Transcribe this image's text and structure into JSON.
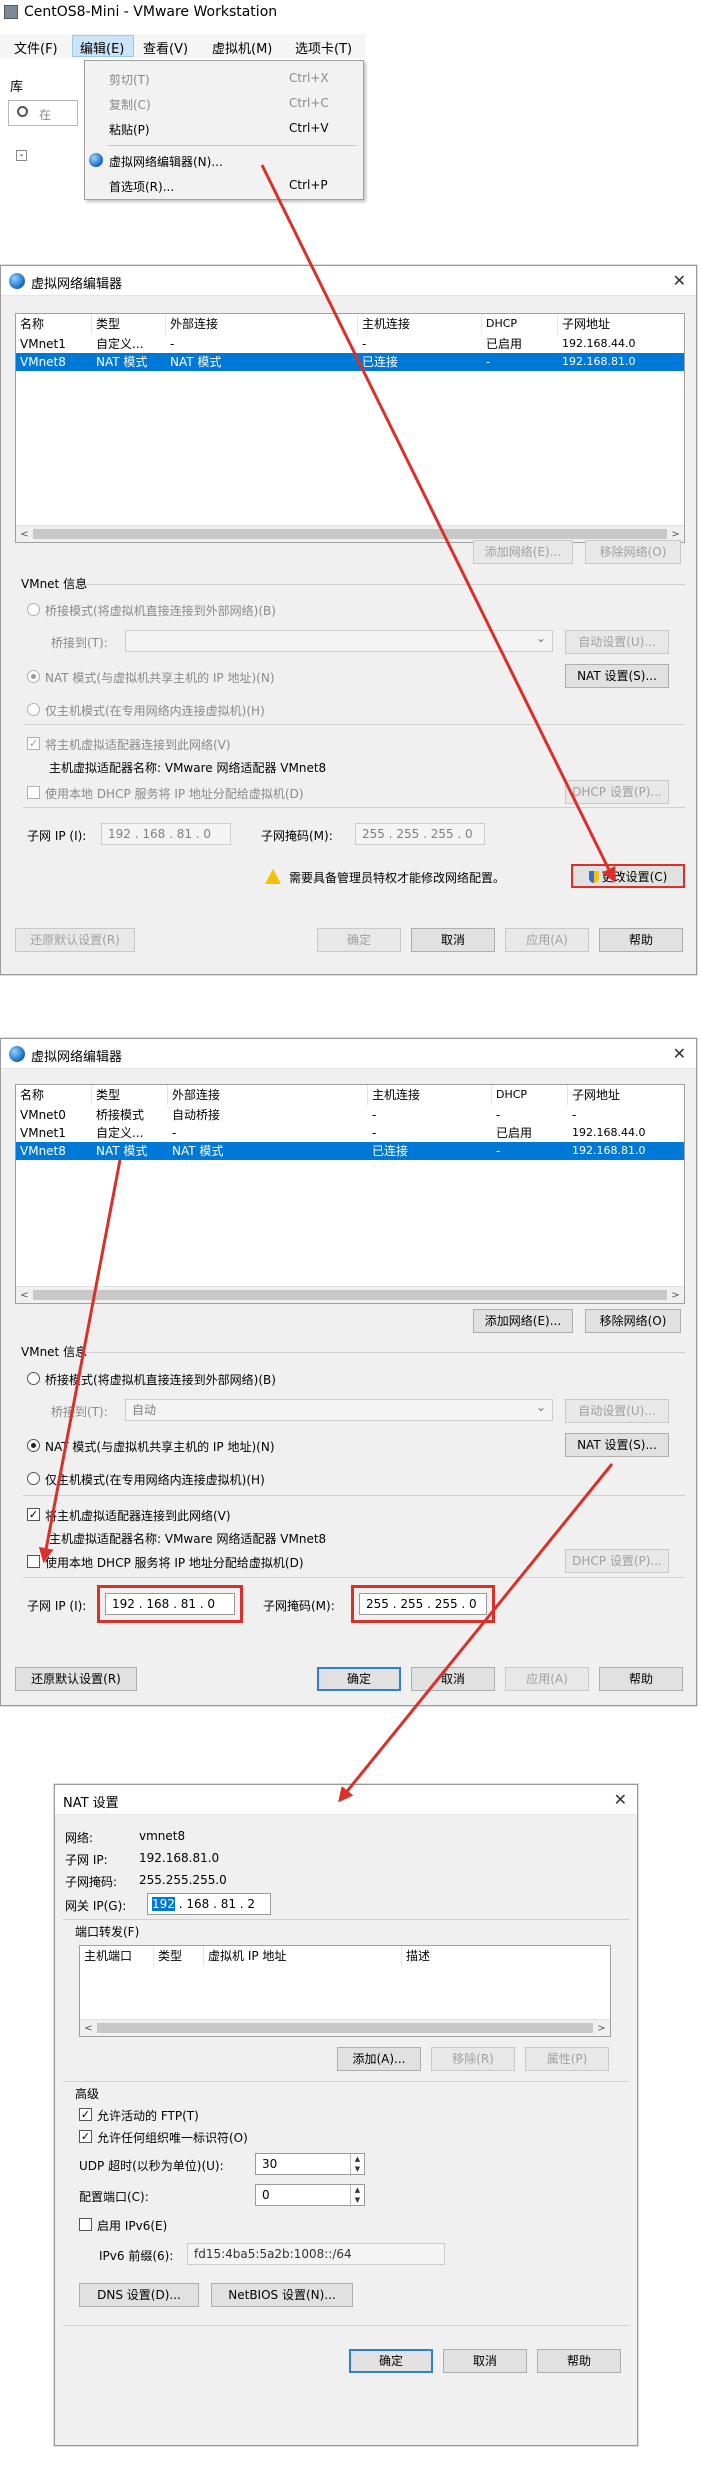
{
  "menu_window": {
    "title": "CentOS8-Mini - VMware Workstation",
    "menubar": [
      "文件(F)",
      "编辑(E)",
      "查看(V)",
      "虚拟机(M)",
      "选项卡(T)"
    ],
    "sidebar_label": "库",
    "search_placeholder": "在",
    "edit_menu": [
      {
        "label": "剪切(T)",
        "shortcut": "Ctrl+X"
      },
      {
        "label": "复制(C)",
        "shortcut": "Ctrl+C"
      },
      {
        "label": "粘贴(P)",
        "shortcut": "Ctrl+V"
      },
      {
        "label": "虚拟网络编辑器(N)...",
        "shortcut": ""
      },
      {
        "label": "首选项(R)...",
        "shortcut": "Ctrl+P"
      }
    ]
  },
  "vne1": {
    "title": "虚拟网络编辑器",
    "columns": [
      "名称",
      "类型",
      "外部连接",
      "主机连接",
      "DHCP",
      "子网地址"
    ],
    "rows": [
      [
        "VMnet1",
        "自定义...",
        "-",
        "-",
        "已启用",
        "192.168.44.0"
      ],
      [
        "VMnet8",
        "NAT 模式",
        "NAT 模式",
        "已连接",
        "-",
        "192.168.81.0"
      ]
    ],
    "add_network": "添加网络(E)...",
    "remove_network": "移除网络(O)",
    "vmnet_info": "VMnet 信息",
    "bridged": "桥接模式(将虚拟机直接连接到外部网络)(B)",
    "bridge_to": "桥接到(T):",
    "bridge_value": "",
    "auto_settings": "自动设置(U)...",
    "nat_mode": "NAT 模式(与虚拟机共享主机的 IP 地址)(N)",
    "nat_settings": "NAT 设置(S)...",
    "hostonly": "仅主机模式(在专用网络内连接虚拟机)(H)",
    "connect_adapter": "将主机虚拟适配器连接到此网络(V)",
    "adapter_name": "主机虚拟适配器名称: VMware 网络适配器 VMnet8",
    "use_dhcp": "使用本地 DHCP 服务将 IP 地址分配给虚拟机(D)",
    "dhcp_settings": "DHCP 设置(P)...",
    "subnet_ip_label": "子网 IP (I):",
    "subnet_ip": "192 . 168 . 81 . 0",
    "mask_label": "子网掩码(M):",
    "mask": "255 . 255 . 255 . 0",
    "admin_notice": "需要具备管理员特权才能修改网络配置。",
    "change_settings": "更改设置(C)",
    "restore": "还原默认设置(R)",
    "ok": "确定",
    "cancel": "取消",
    "apply": "应用(A)",
    "help": "帮助"
  },
  "vne2": {
    "title": "虚拟网络编辑器",
    "columns": [
      "名称",
      "类型",
      "外部连接",
      "主机连接",
      "DHCP",
      "子网地址"
    ],
    "rows": [
      [
        "VMnet0",
        "桥接模式",
        "自动桥接",
        "-",
        "-",
        "-"
      ],
      [
        "VMnet1",
        "自定义...",
        "-",
        "-",
        "已启用",
        "192.168.44.0"
      ],
      [
        "VMnet8",
        "NAT 模式",
        "NAT 模式",
        "已连接",
        "-",
        "192.168.81.0"
      ]
    ],
    "add_network": "添加网络(E)...",
    "remove_network": "移除网络(O)",
    "vmnet_info": "VMnet 信息",
    "bridged": "桥接模式(将虚拟机直接连接到外部网络)(B)",
    "bridge_to": "桥接到(T):",
    "bridge_value": "自动",
    "auto_settings": "自动设置(U)...",
    "nat_mode": "NAT 模式(与虚拟机共享主机的 IP 地址)(N)",
    "nat_settings": "NAT 设置(S)...",
    "hostonly": "仅主机模式(在专用网络内连接虚拟机)(H)",
    "connect_adapter": "将主机虚拟适配器连接到此网络(V)",
    "adapter_name": "主机虚拟适配器名称: VMware 网络适配器 VMnet8",
    "use_dhcp": "使用本地 DHCP 服务将 IP 地址分配给虚拟机(D)",
    "dhcp_settings": "DHCP 设置(P)...",
    "subnet_ip_label": "子网 IP (I):",
    "subnet_ip": "192 . 168 . 81 . 0",
    "mask_label": "子网掩码(M):",
    "mask": "255 . 255 . 255 . 0",
    "restore": "还原默认设置(R)",
    "ok": "确定",
    "cancel": "取消",
    "apply": "应用(A)",
    "help": "帮助"
  },
  "nat": {
    "title": "NAT 设置",
    "network_label": "网络:",
    "network": "vmnet8",
    "subnet_ip_label": "子网 IP:",
    "subnet_ip": "192.168.81.0",
    "mask_label": "子网掩码:",
    "mask": "255.255.255.0",
    "gateway_label": "网关 IP(G):",
    "gateway_sel": "192",
    "gateway_rest": " . 168 . 81 . 2",
    "port_forwarding": "端口转发(F)",
    "pf_columns": [
      "主机端口",
      "类型",
      "虚拟机 IP 地址",
      "描述"
    ],
    "add": "添加(A)...",
    "remove": "移除(R)",
    "properties": "属性(P)",
    "advanced": "高级",
    "allow_ftp": "允许活动的 FTP(T)",
    "allow_oui": "允许任何组织唯一标识符(O)",
    "udp_label": "UDP 超时(以秒为单位)(U):",
    "udp_value": "30",
    "config_port_label": "配置端口(C):",
    "config_port": "0",
    "enable_ipv6": "启用 IPv6(E)",
    "ipv6_prefix_label": "IPv6 前缀(6):",
    "ipv6_prefix": "fd15:4ba5:5a2b:1008::/64",
    "dns_settings": "DNS 设置(D)...",
    "netbios_settings": "NetBIOS 设置(N)...",
    "ok": "确定",
    "cancel": "取消",
    "help": "帮助"
  },
  "colors": {
    "selection": "#0078d7",
    "annotation_red": "#d9302a",
    "window_bg": "#f0f0f0"
  }
}
